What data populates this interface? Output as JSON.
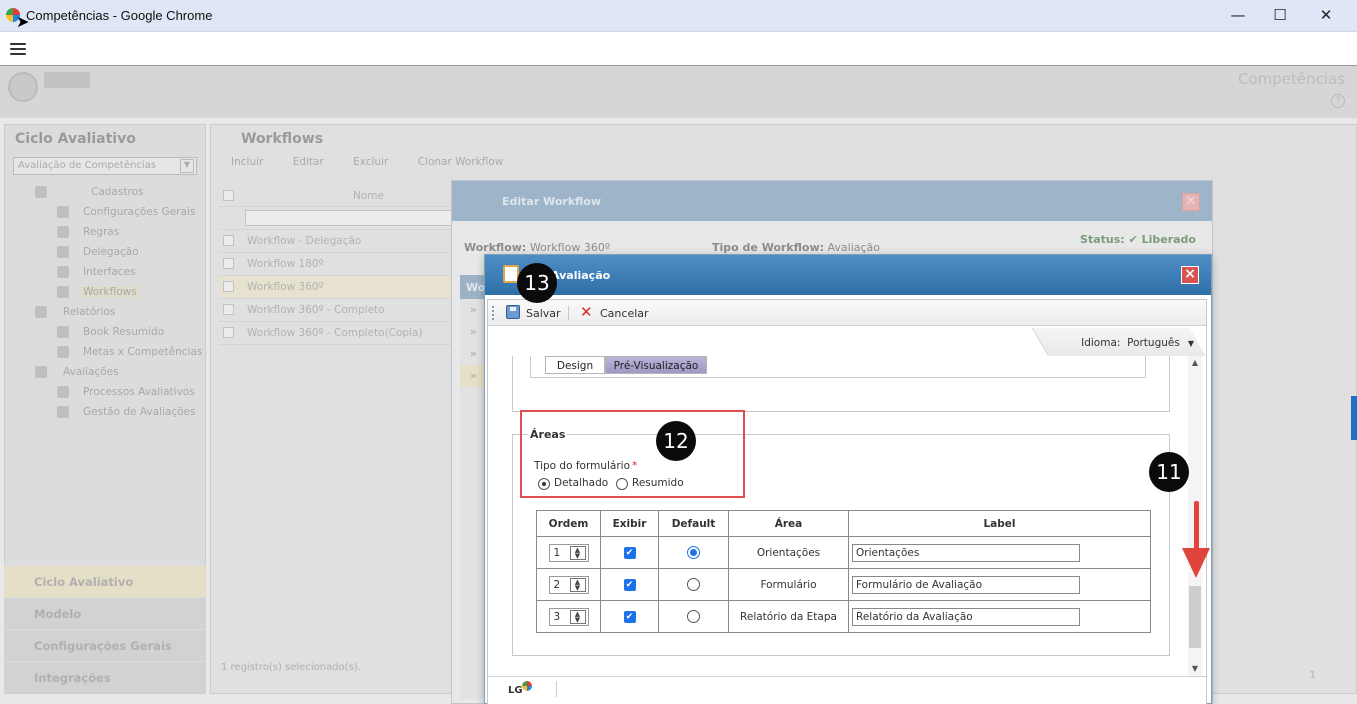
{
  "window": {
    "title": "Competências - Google Chrome",
    "minimize": "—",
    "maximize": "☐",
    "close": "✕"
  },
  "app": {
    "page_title": "Competências",
    "help": "?",
    "sidebar": {
      "title": "Ciclo Avaliativo",
      "select_value": "Avaliação de Competências",
      "tree": [
        {
          "label": "Cadastros"
        },
        {
          "label": "Configurações Gerais"
        },
        {
          "label": "Regras"
        },
        {
          "label": "Delegação"
        },
        {
          "label": "Interfaces"
        },
        {
          "label": "Workflows"
        },
        {
          "label": "Relatórios"
        },
        {
          "label": "Book Resumido"
        },
        {
          "label": "Metas x Competências"
        },
        {
          "label": "Avaliações"
        },
        {
          "label": "Processos Avaliativos"
        },
        {
          "label": "Gestão de Avaliações"
        }
      ],
      "tabs": [
        "Ciclo Avaliativo",
        "Modelo",
        "Configurações Gerais",
        "Integrações"
      ]
    },
    "main": {
      "title": "Workflows",
      "toolbar": [
        "Incluir",
        "Editar",
        "Excluir",
        "Clonar Workflow"
      ],
      "grid_header": "Nome",
      "rows": [
        "Workflow - Delegação",
        "Workflow 180º",
        "Workflow 360º",
        "Workflow 360º - Completo",
        "Workflow 360º - Completo(Copia)"
      ],
      "status": "1 registro(s) selecionado(s).",
      "pager": "1"
    }
  },
  "workflow_modal": {
    "title": "Editar Workflow",
    "workflow_label": "Workflow:",
    "workflow_value": "Workflow 360º",
    "tipo_label": "Tipo de Workflow:",
    "tipo_value": "Avaliação",
    "status_label": "Status:",
    "status_value": "Liberado",
    "side_tab": "Wo",
    "row_marker": "»"
  },
  "modal": {
    "title": "Avaliação",
    "save_label": "Salvar",
    "cancel_label": "Cancelar",
    "idioma_label": "Idioma:",
    "idioma_value": "Português",
    "tabs": {
      "design": "Design",
      "preview": "Pré-Visualização"
    },
    "areas_legend": "Áreas",
    "tipo_formulario_label": "Tipo do formulário",
    "required_mark": "*",
    "radio_detalhado": "Detalhado",
    "radio_resumido": "Resumido",
    "table": {
      "headers": [
        "Ordem",
        "Exibir",
        "Default",
        "Área",
        "Label"
      ],
      "rows": [
        {
          "ordem": "1",
          "exibir": true,
          "default": true,
          "area": "Orientações",
          "label": "Orientações"
        },
        {
          "ordem": "2",
          "exibir": true,
          "default": false,
          "area": "Formulário",
          "label": "Formulário de Avaliação"
        },
        {
          "ordem": "3",
          "exibir": true,
          "default": false,
          "area": "Relatório da Etapa",
          "label": "Relatório da Avaliação"
        }
      ]
    },
    "footer_logo": "LG"
  },
  "annotations": {
    "badge_11": "11",
    "badge_12": "12",
    "badge_13": "13",
    "red": "#e04e4e"
  }
}
